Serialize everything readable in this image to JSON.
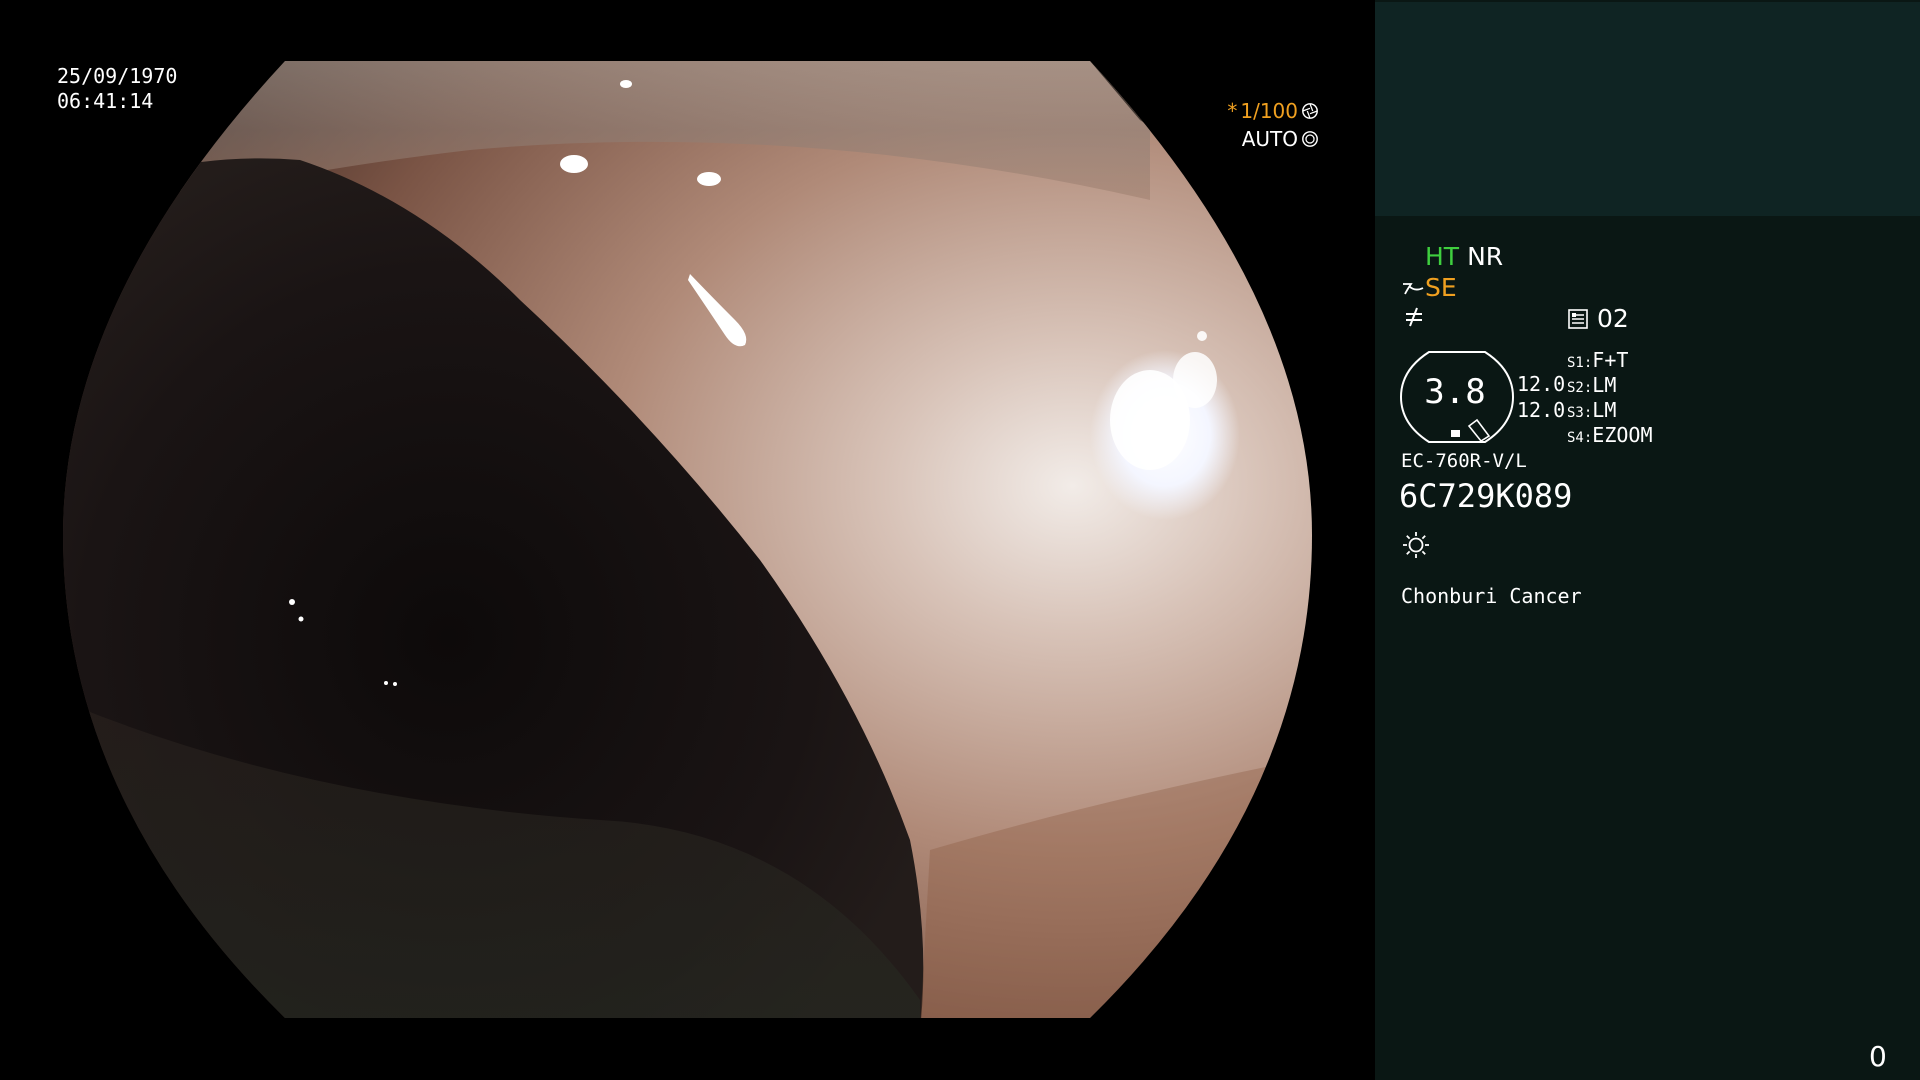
{
  "scope_view": {
    "date": "25/09/1970",
    "time": "06:41:14",
    "shutter": {
      "prefix": "*",
      "value": "1/100",
      "icon": "shutter-aperture-icon"
    },
    "iris": {
      "label": "AUTO",
      "icon": "iris-icon"
    }
  },
  "info_panel": {
    "modes": {
      "ht": "HT",
      "nr": "NR"
    },
    "structure_enhance": {
      "icon": "enhance-curve-icon",
      "label": "SE"
    },
    "function_icon": "not-equal-icon",
    "preset": {
      "icon": "list-memo-icon",
      "value": "02"
    },
    "gauge": {
      "value": "3.8",
      "side_top": "12.0",
      "side_bottom": "12.0",
      "icon": "scope-gauge-icon"
    },
    "switches": [
      {
        "key": "S1:",
        "value": "F+T"
      },
      {
        "key": "S2:",
        "value": "LM"
      },
      {
        "key": "S3:",
        "value": "LM"
      },
      {
        "key": "S4:",
        "value": "EZOOM"
      }
    ],
    "scope_model": "EC-760R-V/L",
    "scope_serial": "6C729K089",
    "light_icon": "sun-icon",
    "hospital": "Chonburi Cancer",
    "counter": "0"
  },
  "colors": {
    "panel_bg": "#0a1714",
    "panel_top_block": "#0f2423",
    "ht_green": "#3fcf3f",
    "accent_orange": "#f0a020",
    "text_white": "#ffffff"
  }
}
